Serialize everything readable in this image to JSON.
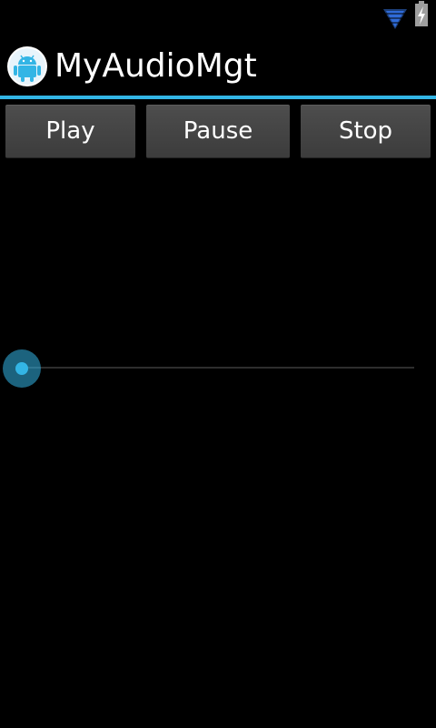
{
  "status_bar": {
    "wifi_icon": "wifi-icon",
    "battery_icon": "battery-charging-icon"
  },
  "action_bar": {
    "app_icon": "android-icon",
    "title": "MyAudioMgt",
    "accent_color": "#33b5e5"
  },
  "controls": {
    "play_label": "Play",
    "pause_label": "Pause",
    "stop_label": "Stop"
  },
  "seekbar": {
    "progress_fraction": 0.0
  }
}
